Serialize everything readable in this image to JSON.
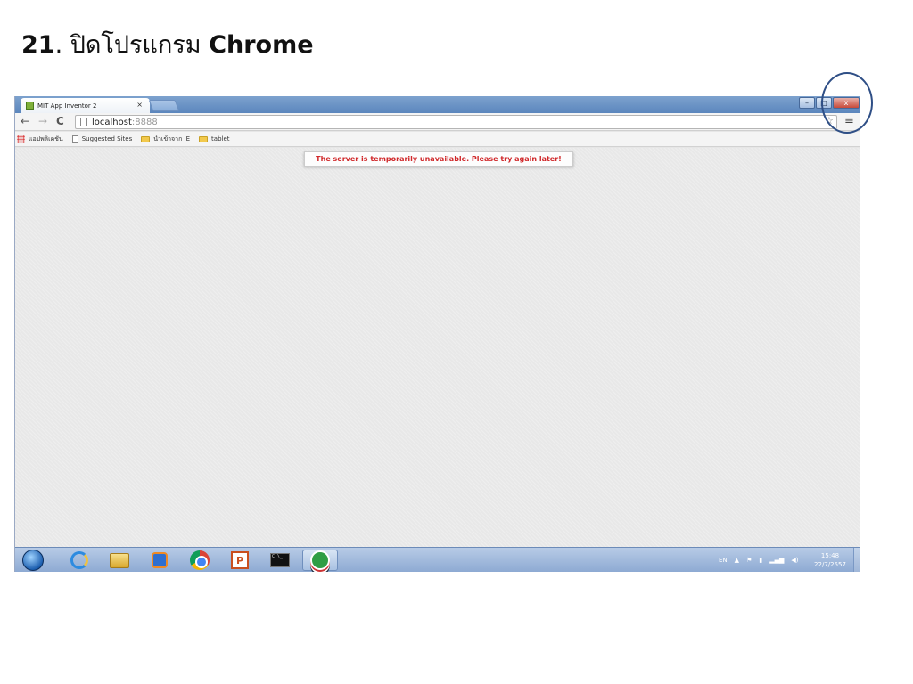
{
  "slide": {
    "title_number": "21",
    "title_text": ". ปิดโปรแกรม ",
    "title_bold": "Chrome"
  },
  "browser": {
    "tab_title": "MIT App Inventor 2",
    "tab_close": "×",
    "window_buttons": {
      "minimize": "–",
      "maximize": "□",
      "close": "x"
    },
    "nav": {
      "back": "←",
      "forward": "→",
      "reload": "C"
    },
    "address": {
      "host": "localhost",
      "port": ":8888"
    },
    "star": "☆",
    "menu": "≡",
    "bookmarks": [
      {
        "label": "แอปพลิเคชัน",
        "icon": "apps-grid-icon"
      },
      {
        "label": "Suggested Sites",
        "icon": "page-icon"
      },
      {
        "label": "นำเข้าจาก IE",
        "icon": "folder-icon"
      },
      {
        "label": "tablet",
        "icon": "folder-icon"
      }
    ],
    "error_message": "The server is temporarily unavailable. Please try again later!"
  },
  "taskbar": {
    "apps": [
      "start-orb",
      "internet-explorer-icon",
      "file-explorer-icon",
      "media-player-icon",
      "chrome-icon",
      "powerpoint-icon",
      "command-prompt-icon",
      "emulator-icon"
    ],
    "ppt_glyph": "P",
    "cmd_glyph": "C:\\_",
    "tray": {
      "language": "EN",
      "up_arrow": "▲",
      "flag": "⚑",
      "battery": "▮",
      "signal": "▂▄▆",
      "volume": "◀)"
    },
    "time": "15:48",
    "date": "22/7/2557"
  }
}
